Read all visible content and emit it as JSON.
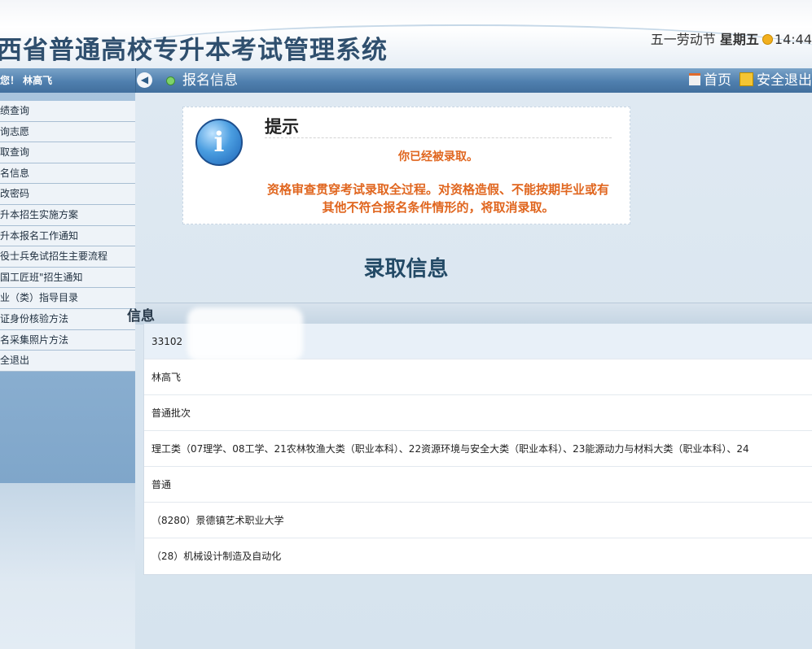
{
  "header": {
    "title": "西省普通高校专升本考试管理系统",
    "holiday": "五一劳动节",
    "weekday": "星期五",
    "time": "14:44"
  },
  "topbar": {
    "user": "您！ 林高飞",
    "breadcrumb": "报名信息",
    "home_label": "首页",
    "exit_label": "安全退出"
  },
  "sidebar": {
    "items": [
      "绩查询",
      "询志愿",
      "取查询",
      "名信息",
      "改密码",
      "升本招生实施方案",
      "升本报名工作通知",
      "役士兵免试招生主要流程",
      "国工匠班\"招生通知",
      "业（类）指导目录",
      "证身份核验方法",
      "名采集照片方法",
      "全退出"
    ]
  },
  "notice": {
    "title": "提示",
    "message": "你已经被录取。",
    "warning": "资格审查贯穿考试录取全过程。对资格造假、不能按期毕业或有其他不符合报名条件情形的，将取消录取。"
  },
  "main": {
    "section_title": "录取信息",
    "subsection_title": "信息",
    "rows": [
      "33102",
      "林高飞",
      "普通批次",
      "理工类（07理学、08工学、21农林牧渔大类（职业本科）、22资源环境与安全大类（职业本科）、23能源动力与材料大类（职业本科）、24",
      "普通",
      "（8280）景德镇艺术职业大学",
      "（28）机械设计制造及自动化"
    ]
  },
  "colors": {
    "topbar": "#4f7fae",
    "warning_text": "#e0661f",
    "title_text": "#2f4f6e"
  }
}
